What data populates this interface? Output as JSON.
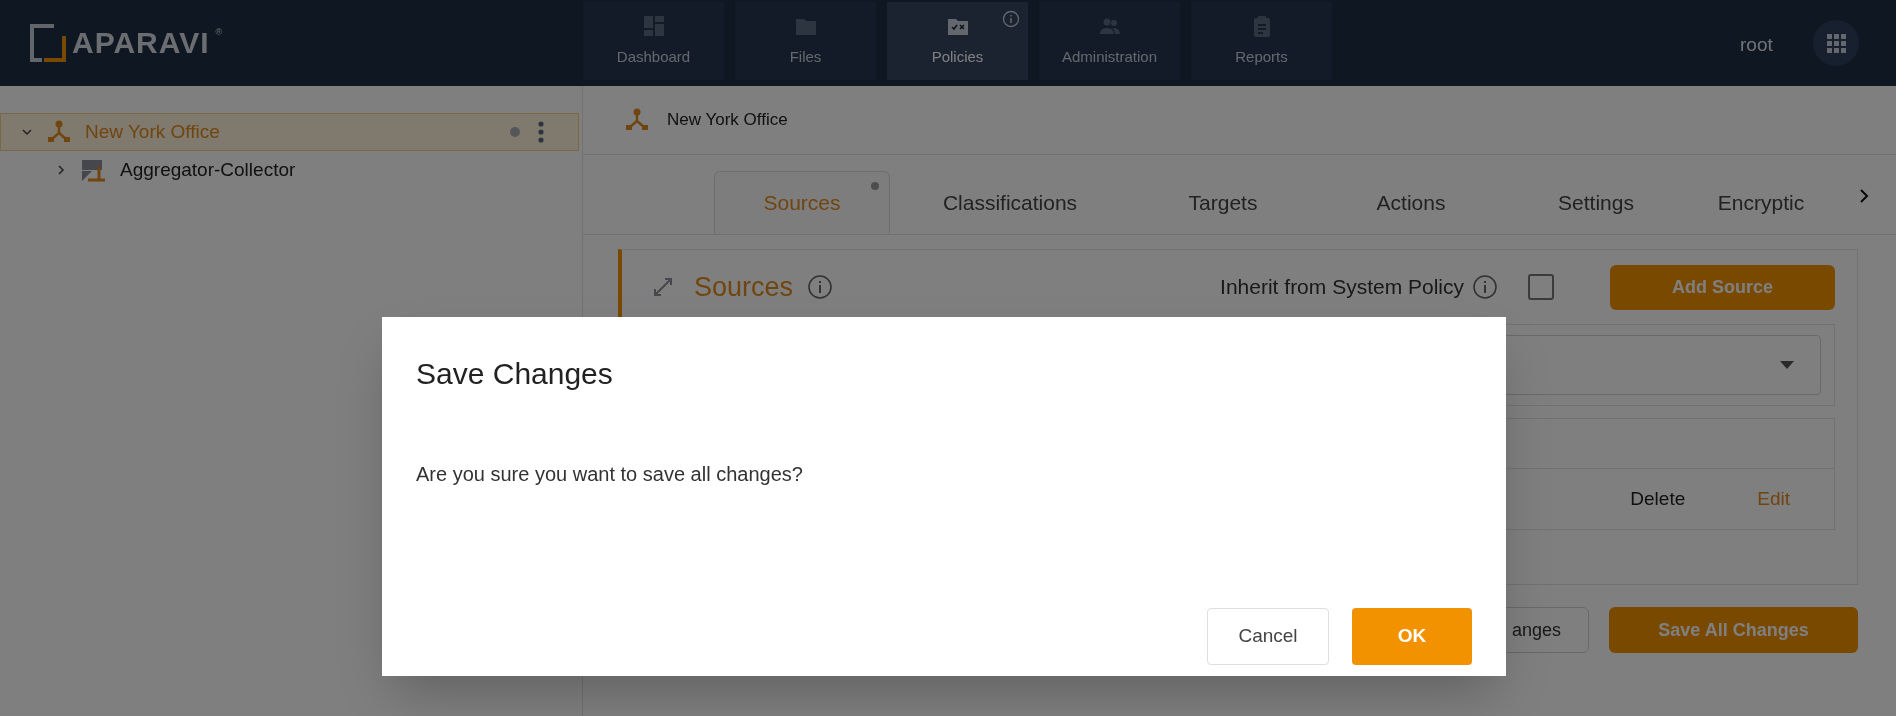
{
  "header": {
    "logo": "APARAVI",
    "logo_mark": "®",
    "nav": [
      {
        "label": "Dashboard",
        "selected": false,
        "info": false
      },
      {
        "label": "Files",
        "selected": false,
        "info": false
      },
      {
        "label": "Policies",
        "selected": true,
        "info": true
      },
      {
        "label": "Administration",
        "selected": false,
        "info": false
      },
      {
        "label": "Reports",
        "selected": false,
        "info": false
      }
    ],
    "user": "root"
  },
  "tree": [
    {
      "label": "New York Office",
      "kind": "group",
      "selected": true,
      "expanded": true,
      "children": [
        {
          "label": "Aggregator-Collector",
          "kind": "collector",
          "selected": false,
          "expanded": false
        }
      ]
    }
  ],
  "breadcrumb": "New York Office",
  "tabs": [
    {
      "label": "Sources",
      "selected": true,
      "modified": true
    },
    {
      "label": "Classifications",
      "selected": false,
      "modified": false
    },
    {
      "label": "Targets",
      "selected": false,
      "modified": false
    },
    {
      "label": "Actions",
      "selected": false,
      "modified": false
    },
    {
      "label": "Settings",
      "selected": false,
      "modified": false
    },
    {
      "label": "Encryptic",
      "selected": false,
      "modified": false
    }
  ],
  "sources_panel": {
    "title": "Sources",
    "inherit_label": "Inherit from System Policy",
    "inherit_checked": false,
    "add_button": "Add Source",
    "row_actions": [
      "Delete",
      "Edit"
    ]
  },
  "footer_buttons": [
    {
      "label": "anges",
      "kind": "secondary"
    },
    {
      "label": "Save All Changes",
      "kind": "primary"
    }
  ],
  "dialog": {
    "title": "Save Changes",
    "message": "Are you sure you want to save all changes?",
    "buttons": [
      {
        "label": "Cancel",
        "kind": "secondary"
      },
      {
        "label": "OK",
        "kind": "primary"
      }
    ]
  }
}
